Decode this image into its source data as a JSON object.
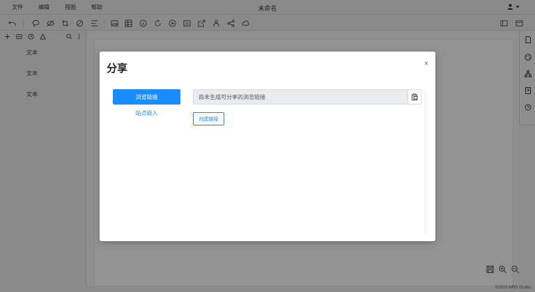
{
  "menubar": {
    "items": [
      "文件",
      "编辑",
      "视图",
      "帮助"
    ],
    "title": "未命名"
  },
  "left_panel": {
    "items": [
      "文本",
      "文本",
      "文本"
    ]
  },
  "modal": {
    "title": "分享",
    "close": "×",
    "nav_active": "浏览链接",
    "nav_link": "站点嵌入",
    "link_placeholder": "尚未生成可分享的浏览链接",
    "create_button": "创建链接"
  },
  "footer": {
    "copyright": "©2023 NRD Studio"
  },
  "colors": {
    "accent": "#1a8cff",
    "overlay": "#8c8c8c"
  }
}
